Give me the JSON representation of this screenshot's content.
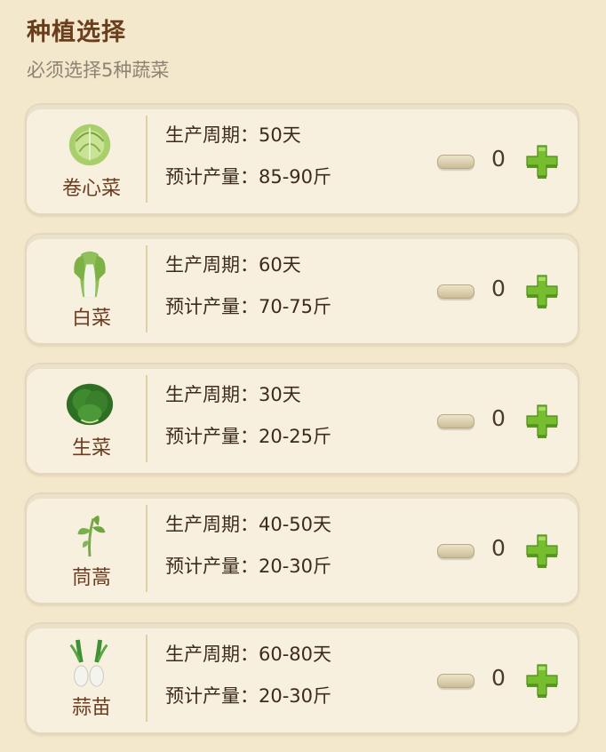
{
  "header": {
    "title": "种植选择",
    "subtitle": "必须选择5种蔬菜"
  },
  "labels": {
    "cycle": "生产周期：",
    "yield": "预计产量："
  },
  "vegetables": [
    {
      "name": "卷心菜",
      "icon": "cabbage-icon",
      "cycle": "50天",
      "yield": "85-90斤",
      "qty": "0"
    },
    {
      "name": "白菜",
      "icon": "bok-choy-icon",
      "cycle": "60天",
      "yield": "70-75斤",
      "qty": "0"
    },
    {
      "name": "生菜",
      "icon": "lettuce-icon",
      "cycle": "30天",
      "yield": "20-25斤",
      "qty": "0"
    },
    {
      "name": "茼蒿",
      "icon": "chrysanthemum-greens-icon",
      "cycle": "40-50天",
      "yield": "20-30斤",
      "qty": "0"
    },
    {
      "name": "蒜苗",
      "icon": "garlic-sprout-icon",
      "cycle": "60-80天",
      "yield": "20-30斤",
      "qty": "0"
    }
  ],
  "colors": {
    "background": "#f3e8cb",
    "card": "#f8f0df",
    "title": "#6a3d1c",
    "plus_green": "#6db02a"
  }
}
